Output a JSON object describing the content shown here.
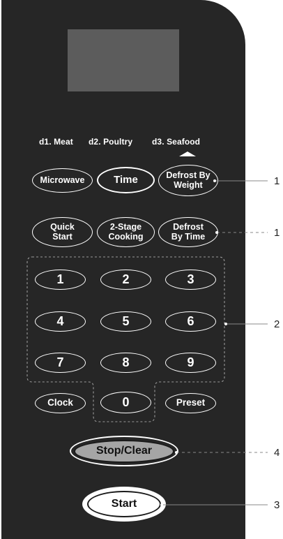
{
  "defrost_labels": [
    "d1. Meat",
    "d2. Poultry",
    "d3. Seafood"
  ],
  "buttons": {
    "microwave": "Microwave",
    "time": "Time",
    "defrost_weight": "Defrost By\nWeight",
    "quick_start": "Quick\nStart",
    "two_stage": "2-Stage\nCooking",
    "defrost_time": "Defrost\nBy Time",
    "n1": "1",
    "n2": "2",
    "n3": "3",
    "n4": "4",
    "n5": "5",
    "n6": "6",
    "n7": "7",
    "n8": "8",
    "n9": "9",
    "n0": "0",
    "clock": "Clock",
    "preset": "Preset",
    "stop_clear": "Stop/Clear",
    "start": "Start"
  },
  "callouts": [
    "1",
    "1",
    "2",
    "4",
    "3"
  ],
  "colors": {
    "panel": "#262626",
    "display": "#5c5c5c",
    "stop_button": "#a5a5a5"
  }
}
